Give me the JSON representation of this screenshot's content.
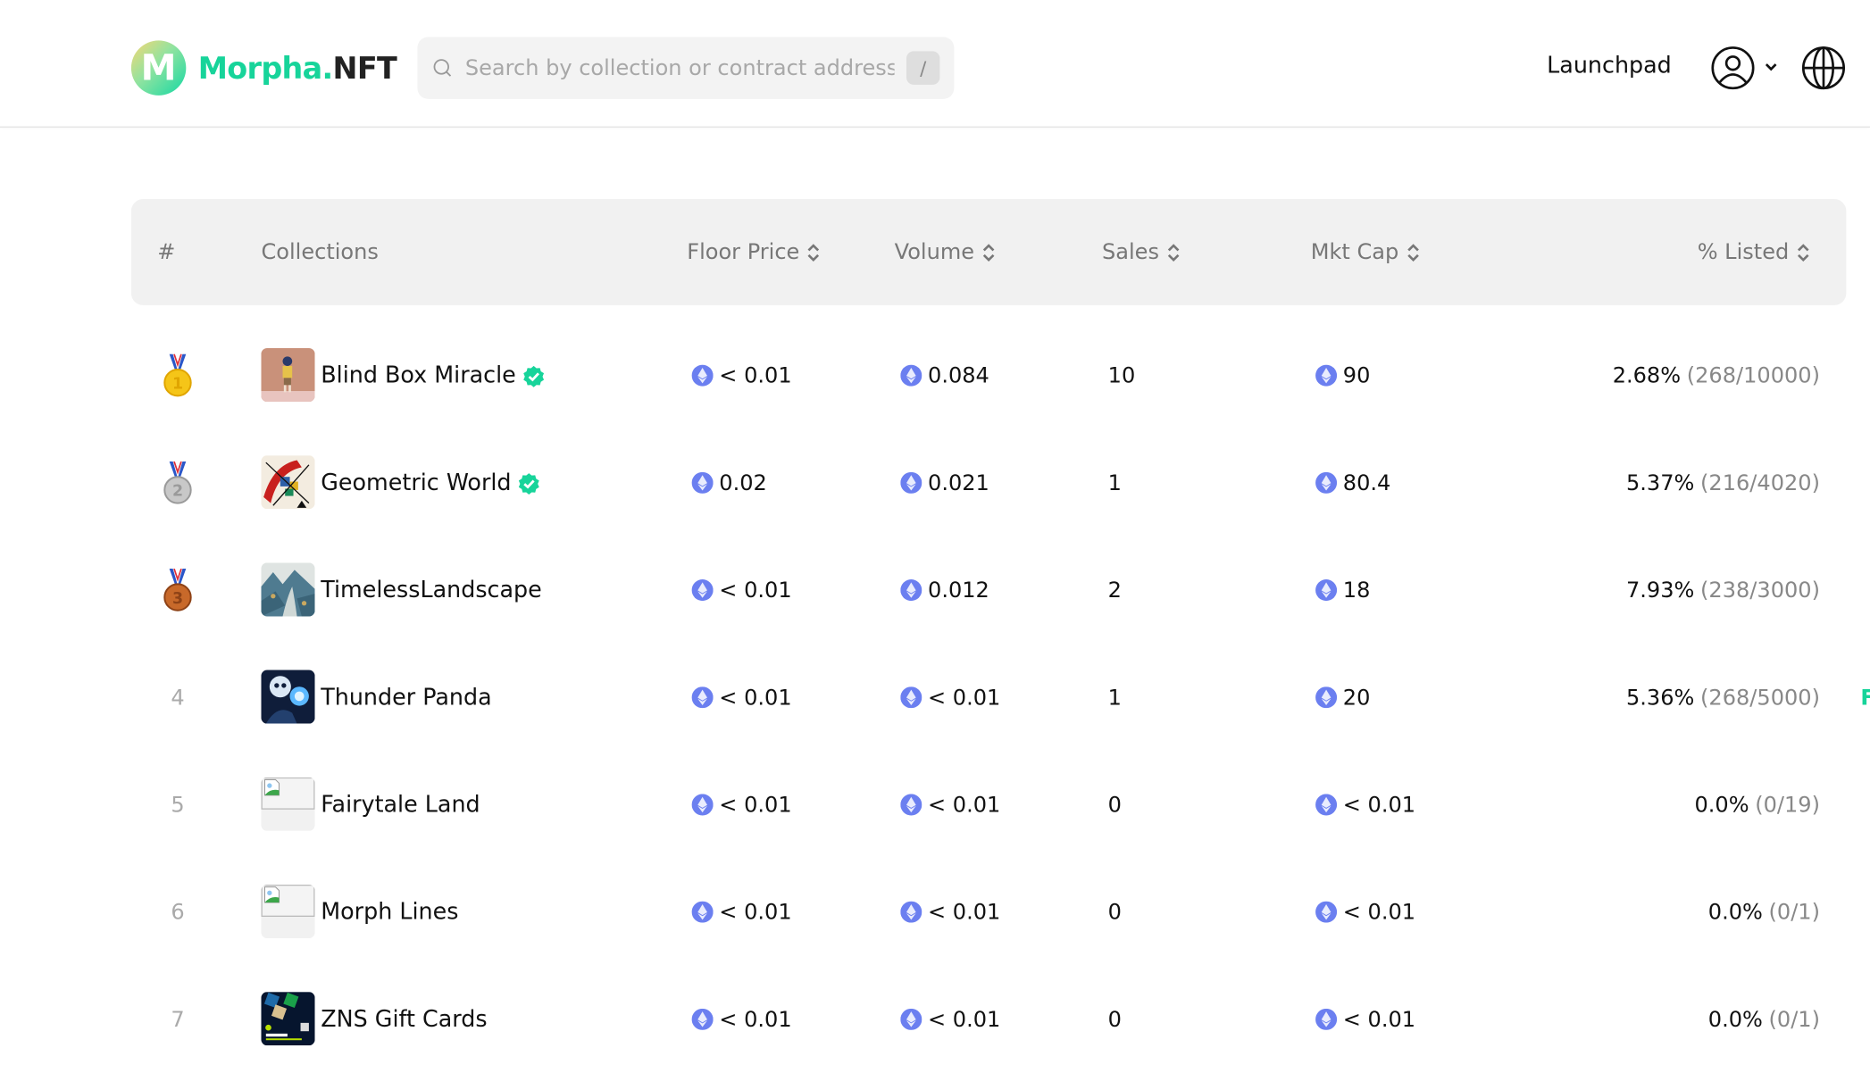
{
  "header": {
    "logo": {
      "brand": "Morpha.",
      "suffix": "NFT",
      "mark": "M"
    },
    "search": {
      "placeholder": "Search by collection or contract address",
      "value": "",
      "shortcut": "/"
    },
    "nav": {
      "launchpad": "Launchpad"
    },
    "icons": {
      "user": "user-circle-icon",
      "menu": "chevron-down-icon",
      "language": "globe-icon"
    }
  },
  "colors": {
    "brand": "#17d49a",
    "eth": "#6b7ff0",
    "verified": "#17d49a"
  },
  "table": {
    "columns": [
      {
        "key": "rank",
        "label": "#",
        "sortable": false
      },
      {
        "key": "collection",
        "label": "Collections",
        "sortable": false
      },
      {
        "key": "floor",
        "label": "Floor Price",
        "sortable": true
      },
      {
        "key": "volume",
        "label": "Volume",
        "sortable": true
      },
      {
        "key": "sales",
        "label": "Sales",
        "sortable": true
      },
      {
        "key": "mktcap",
        "label": "Mkt Cap",
        "sortable": true
      },
      {
        "key": "listed",
        "label": "% Listed",
        "sortable": true
      }
    ],
    "rows": [
      {
        "rank": "1",
        "medal": "gold",
        "name": "Blind Box Miracle",
        "verified": true,
        "thumb": "figure",
        "floor": "< 0.01",
        "volume": "0.084",
        "sales": "10",
        "mktcap": "90",
        "listed_pct": "2.68%",
        "listed_frac": "(268/10000)"
      },
      {
        "rank": "2",
        "medal": "silver",
        "name": "Geometric World",
        "verified": true,
        "thumb": "geometric",
        "floor": "0.02",
        "volume": "0.021",
        "sales": "1",
        "mktcap": "80.4",
        "listed_pct": "5.37%",
        "listed_frac": "(216/4020)"
      },
      {
        "rank": "3",
        "medal": "bronze",
        "name": "TimelessLandscape",
        "verified": false,
        "thumb": "landscape",
        "floor": "< 0.01",
        "volume": "0.012",
        "sales": "2",
        "mktcap": "18",
        "listed_pct": "7.93%",
        "listed_frac": "(238/3000)"
      },
      {
        "rank": "4",
        "medal": null,
        "name": "Thunder Panda",
        "verified": false,
        "thumb": "panda",
        "floor": "< 0.01",
        "volume": "< 0.01",
        "sales": "1",
        "mktcap": "20",
        "listed_pct": "5.36%",
        "listed_frac": "(268/5000)"
      },
      {
        "rank": "5",
        "medal": null,
        "name": "Fairytale Land",
        "verified": false,
        "thumb": "broken",
        "floor": "< 0.01",
        "volume": "< 0.01",
        "sales": "0",
        "mktcap": "< 0.01",
        "listed_pct": "0.0%",
        "listed_frac": "(0/19)"
      },
      {
        "rank": "6",
        "medal": null,
        "name": "Morph Lines",
        "verified": false,
        "thumb": "broken",
        "floor": "< 0.01",
        "volume": "< 0.01",
        "sales": "0",
        "mktcap": "< 0.01",
        "listed_pct": "0.0%",
        "listed_frac": "(0/1)"
      },
      {
        "rank": "7",
        "medal": null,
        "name": "ZNS Gift Cards",
        "verified": false,
        "thumb": "giftcard",
        "floor": "< 0.01",
        "volume": "< 0.01",
        "sales": "0",
        "mktcap": "< 0.01",
        "listed_pct": "0.0%",
        "listed_frac": "(0/1)"
      }
    ]
  },
  "edge_fragment": "F"
}
